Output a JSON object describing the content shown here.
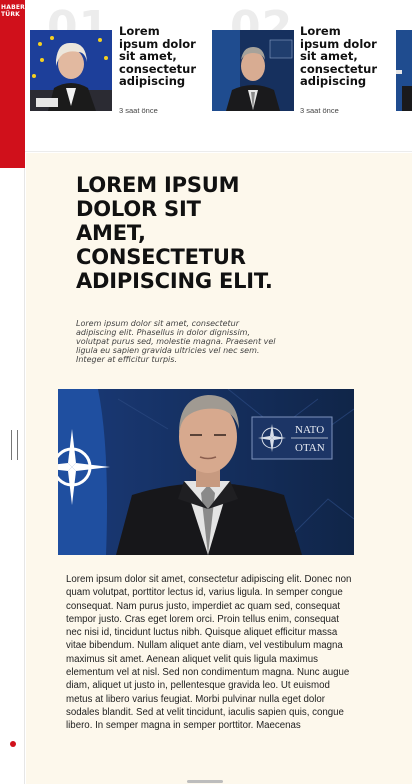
{
  "brand": {
    "line1": "HABER",
    "line2": "TÜRK"
  },
  "news_strip": [
    {
      "number": "01",
      "title": "Lorem ipsum dolor sit amet, consectetur adipiscing",
      "time": "3 saat önce"
    },
    {
      "number": "02",
      "title": "Lorem ipsum dolor sit amet, consectetur adipiscing",
      "time": "3 saat önce"
    }
  ],
  "article": {
    "headline": "LOREM IPSUM DOLOR SIT AMET, CONSECTETUR ADIPISCING ELIT.",
    "summary": "Lorem ipsum dolor sit amet, consectetur adipiscing elit. Phasellus in dolor dignissim, volutpat purus sed, molestie magna. Praesent vel ligula eu sapien gravida ultricies vel nec sem. Integer at efficitur turpis.",
    "image_sign_line1": "NATO",
    "image_sign_line2": "OTAN",
    "body": "Lorem ipsum dolor sit amet, consectetur adipiscing elit. Donec non quam volutpat, porttitor lectus id, varius ligula. In semper congue consequat. Nam purus justo, imperdiet ac quam sed, consequat tempor justo. Cras eget lorem orci. Proin tellus enim, consequat nec nisi id, tincidunt luctus nibh. Quisque aliquet efficitur massa vitae bibendum. Nullam aliquet ante diam, vel vestibulum magna maximus sit amet. Aenean aliquet velit quis ligula maximus elementum vel at nisl. Sed non condimentum magna. Nunc augue diam, aliquet ut justo in, pellentesque gravida leo. Ut euismod metus at libero varius feugiat. Morbi pulvinar nulla eget dolor sodales blandit. Sed at velit tincidunt, iaculis sapien quis, congue libero. In semper magna in semper porttitor. Maecenas"
  },
  "colors": {
    "brand_red": "#d0101b",
    "article_bg": "#fdf8ec"
  }
}
